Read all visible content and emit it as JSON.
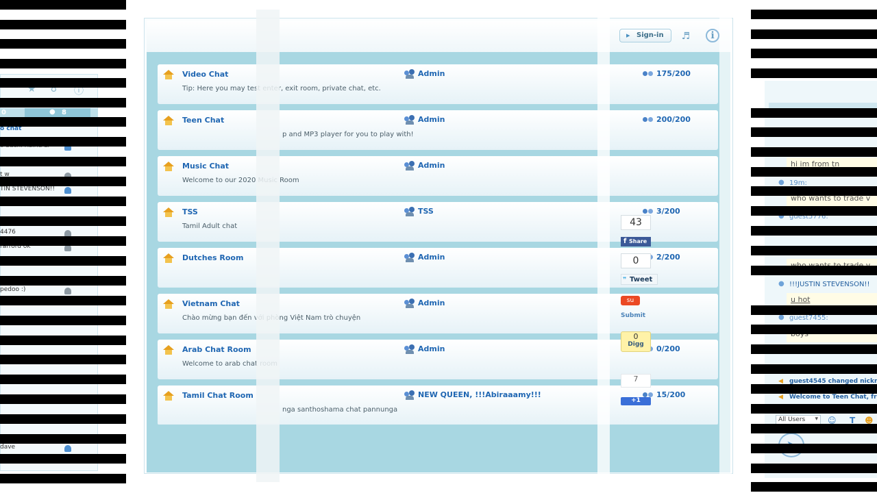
{
  "left_panel": {
    "online_count": "0",
    "chat_count": "8",
    "room_link": "o chat",
    "users": [
      "o Sachi Ruiria Li",
      "t w",
      "TIN STEVENSON!!",
      "4476",
      "rarrord ok",
      "pedoo :)",
      "dave"
    ]
  },
  "header": {
    "signin_label": "Sign-in",
    "icons": [
      "sound-icon",
      "info-icon"
    ]
  },
  "rooms": [
    {
      "name": "Video Chat",
      "description": "Tip: Here you may test enter, exit room, private chat, etc.",
      "owner": "Admin",
      "count": "175/200"
    },
    {
      "name": "Teen Chat",
      "description": "p and MP3 player for you to play with!",
      "owner": "Admin",
      "count": "200/200"
    },
    {
      "name": "Music Chat",
      "description": "Welcome to our 2020 Music Room",
      "owner": "Admin",
      "count": ""
    },
    {
      "name": "TSS",
      "description": "Tamil Adult chat",
      "owner": "TSS",
      "count": "3/200"
    },
    {
      "name": "Dutches Room",
      "description": "",
      "owner": "Admin",
      "count": "2/200"
    },
    {
      "name": "Vietnam Chat",
      "description": "Chào mừng bạn đến với phòng Việt Nam trò chuyện",
      "owner": "Admin",
      "count": ""
    },
    {
      "name": "Arab Chat Room",
      "description": "Welcome to arab chat room",
      "owner": "Admin",
      "count": "0/200"
    },
    {
      "name": "Tamil Chat Room",
      "description": "nga santhoshama chat pannunga",
      "owner": "NEW QUEEN, !!!Abiraaamy!!!",
      "count": "15/200"
    }
  ],
  "share": {
    "facebook_count": "43",
    "facebook_label": "Share",
    "twitter_count": "0",
    "twitter_label": "Tweet",
    "stumble_label": "Submit",
    "digg_count": "0",
    "digg_label": "Digg",
    "gplus_count": "7",
    "gplus_label": "+1"
  },
  "right_panel": {
    "messages": [
      {
        "text": "hi im from tn"
      },
      {
        "time": "19m:"
      },
      {
        "text": "who wants to trade v"
      },
      {
        "time": "guest5776:"
      },
      {
        "text": "who wants to trade v"
      },
      {
        "user": "!!!JUSTIN STEVENSON!!"
      },
      {
        "text": "u hot"
      },
      {
        "time": "guest7455:"
      },
      {
        "text": "boys"
      }
    ],
    "system": [
      "guest4545 changed nickn",
      "Welcome to Teen Chat, fro"
    ],
    "users_filter": "All Users",
    "font_tool": "T"
  }
}
